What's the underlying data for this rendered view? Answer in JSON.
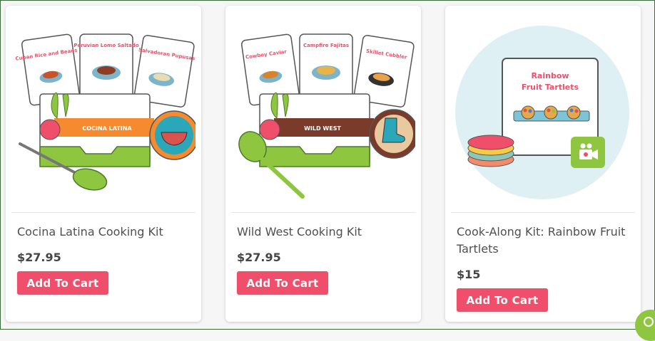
{
  "products": [
    {
      "title": "Cocina Latina Cooking Kit",
      "price": "$27.95",
      "button": "Add To Cart",
      "image_text": {
        "card1": "Cuban Rice and Beans",
        "card2": "Peruvian Lomo Saltado",
        "card3": "Salvadoran Pupusas",
        "banner": "COCINA LATINA"
      }
    },
    {
      "title": "Wild West Cooking Kit",
      "price": "$27.95",
      "button": "Add To Cart",
      "image_text": {
        "card1": "Cowboy Caviar",
        "card2": "Campfire Fajitas",
        "card3": "Skillet Cobbler",
        "banner": "WILD WEST"
      }
    },
    {
      "title": "Cook-Along Kit: Rainbow Fruit Tartlets",
      "price": "$15",
      "button": "Add To Cart",
      "image_text": {
        "card_title_line1": "Rainbow",
        "card_title_line2": "Fruit Tartlets"
      }
    }
  ],
  "colors": {
    "button": "#ef4f6b",
    "latina_banner": "#f58a2e",
    "wildwest_banner": "#7a3b2a",
    "kit_green": "#8ec63f",
    "heading_pink": "#ef4f6b"
  }
}
